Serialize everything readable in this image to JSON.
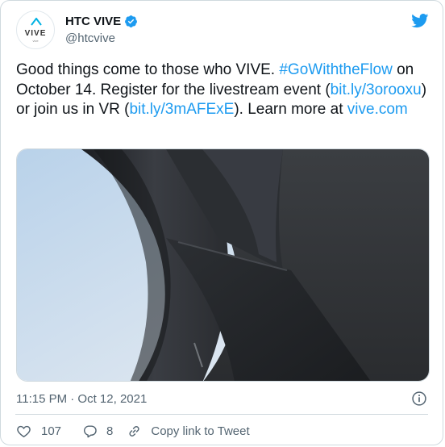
{
  "account": {
    "name": "HTC VIVE",
    "handle": "@htcvive",
    "avatar_logo_text": "VIVE",
    "avatar_logo_sub": "vive"
  },
  "tweet": {
    "text_parts": {
      "p1": "Good things come to those who VIVE. ",
      "hashtag": "#GoWiththeFlow",
      "p2": " on October 14. Register for the livestream event (",
      "link1": "bit.ly/3orooxu",
      "p3": ") or join us in VR (",
      "link2": "bit.ly/3mAFExE",
      "p4": "). Learn more at ",
      "link3": "vive.com"
    },
    "timestamp": "11:15 PM · Oct 12, 2021"
  },
  "actions": {
    "like_count": "107",
    "reply_count": "8",
    "copy_label": "Copy link to Tweet"
  },
  "colors": {
    "link": "#1d9bf0",
    "twitter_blue": "#1d9bf0",
    "text": "#0f1419",
    "secondary": "#536471",
    "border": "#cfd9de"
  },
  "icons": {
    "verified": "verified-badge-icon",
    "twitter": "twitter-bird-icon",
    "info": "info-icon",
    "like": "heart-icon",
    "reply": "reply-bubble-icon",
    "copy": "link-icon"
  }
}
